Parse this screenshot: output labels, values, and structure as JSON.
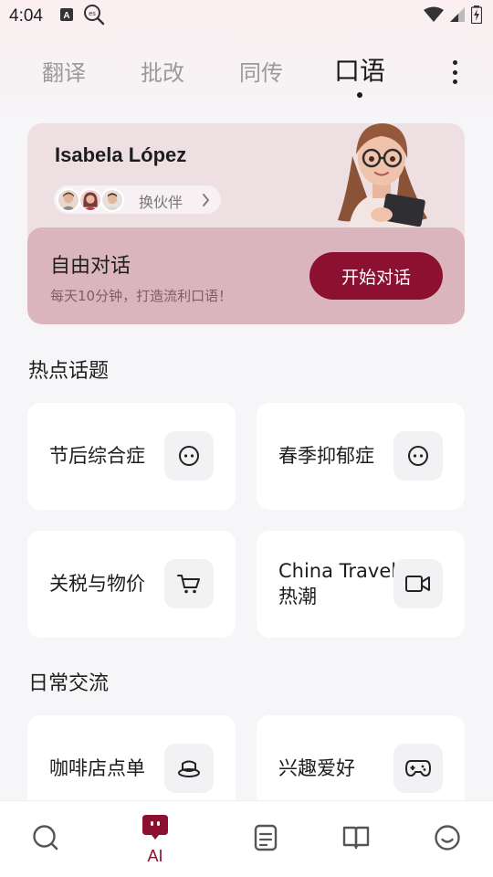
{
  "status_bar": {
    "time": "4:04",
    "left_icons": [
      "keyboard-a-icon",
      "es-search-icon"
    ],
    "right_icons": [
      "wifi-icon",
      "signal-icon",
      "battery-charging-icon"
    ]
  },
  "top_tabs": {
    "items": [
      {
        "label": "翻译",
        "active": false
      },
      {
        "label": "批改",
        "active": false
      },
      {
        "label": "同传",
        "active": false
      },
      {
        "label": "口语",
        "active": true
      }
    ],
    "more_icon": "more-vertical-icon"
  },
  "partner": {
    "name": "Isabela López",
    "switch_label": "换伙伴",
    "switch_icon": "chevron-right-icon"
  },
  "free_chat": {
    "title": "自由对话",
    "subtitle": "每天10分钟，打造流利口语！",
    "button_label": "开始对话"
  },
  "hot_topics": {
    "title": "热点话题",
    "items": [
      {
        "label": "节后综合症",
        "icon": "chat-face-icon"
      },
      {
        "label": "春季抑郁症",
        "icon": "chat-face-icon"
      },
      {
        "label": "关税与物价",
        "icon": "shopping-cart-icon"
      },
      {
        "label": "China Travel 热潮",
        "icon": "video-camera-icon"
      }
    ]
  },
  "daily": {
    "title": "日常交流",
    "items": [
      {
        "label": "咖啡店点单",
        "icon": "coffee-cup-icon"
      },
      {
        "label": "兴趣爱好",
        "icon": "gamepad-icon"
      }
    ]
  },
  "bottom_nav": {
    "items": [
      {
        "icon": "search-icon",
        "label": ""
      },
      {
        "icon": "ai-bot-icon",
        "label": "AI"
      },
      {
        "icon": "notes-icon",
        "label": ""
      },
      {
        "icon": "book-icon",
        "label": ""
      },
      {
        "icon": "smile-face-icon",
        "label": ""
      }
    ]
  },
  "colors": {
    "accent": "#8c1130",
    "card_pink": "#eedfe2",
    "free_chat_bg": "#dbb5bd",
    "page_bg": "#f6f6f8"
  }
}
